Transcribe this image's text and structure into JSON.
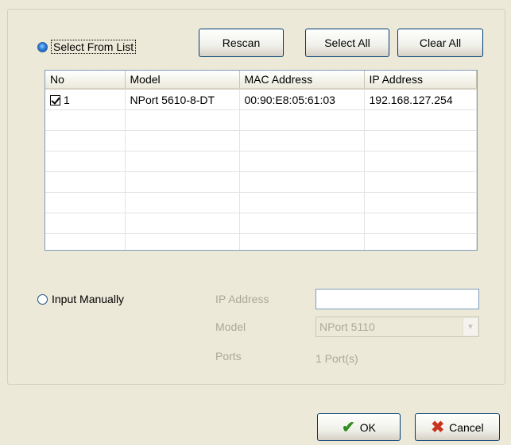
{
  "select_from_list": {
    "label": "Select From List",
    "checked": true
  },
  "buttons": {
    "rescan": "Rescan",
    "select_all": "Select All",
    "clear_all": "Clear All",
    "ok": "OK",
    "cancel": "Cancel"
  },
  "table": {
    "columns": [
      "No",
      "Model",
      "MAC Address",
      "IP Address"
    ],
    "rows": [
      {
        "checked": true,
        "no": "1",
        "model": "NPort 5610-8-DT",
        "mac": "00:90:E8:05:61:03",
        "ip": "192.168.127.254"
      }
    ]
  },
  "input_manually": {
    "label": "Input Manually",
    "checked": false,
    "ip_address_label": "IP Address",
    "ip_address_value": "",
    "model_label": "Model",
    "model_value": "NPort 5110",
    "ports_label": "Ports",
    "ports_value": "1 Port(s)"
  },
  "colors": {
    "window_bg": "#ece9d8",
    "disabled_text": "#aca899",
    "accent": "#2e7cd6"
  }
}
